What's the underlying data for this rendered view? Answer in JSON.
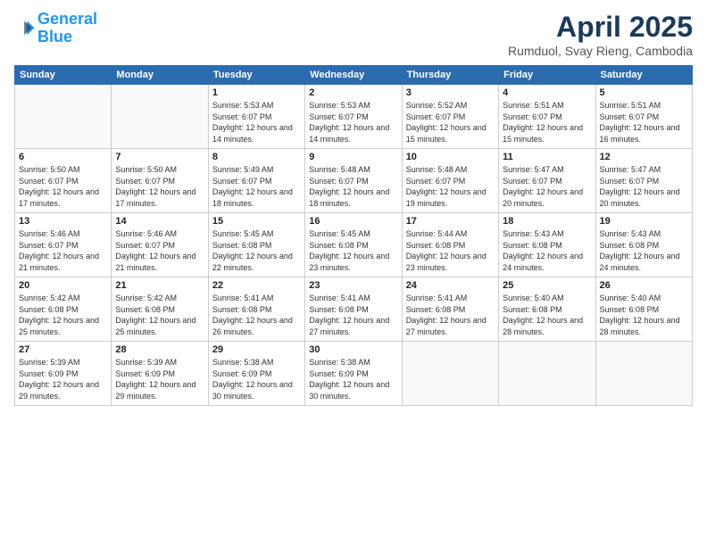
{
  "header": {
    "logo_line1": "General",
    "logo_line2": "Blue",
    "title": "April 2025",
    "subtitle": "Rumduol, Svay Rieng, Cambodia"
  },
  "weekdays": [
    "Sunday",
    "Monday",
    "Tuesday",
    "Wednesday",
    "Thursday",
    "Friday",
    "Saturday"
  ],
  "weeks": [
    [
      {
        "day": "",
        "sunrise": "",
        "sunset": "",
        "daylight": ""
      },
      {
        "day": "",
        "sunrise": "",
        "sunset": "",
        "daylight": ""
      },
      {
        "day": "1",
        "sunrise": "Sunrise: 5:53 AM",
        "sunset": "Sunset: 6:07 PM",
        "daylight": "Daylight: 12 hours and 14 minutes."
      },
      {
        "day": "2",
        "sunrise": "Sunrise: 5:53 AM",
        "sunset": "Sunset: 6:07 PM",
        "daylight": "Daylight: 12 hours and 14 minutes."
      },
      {
        "day": "3",
        "sunrise": "Sunrise: 5:52 AM",
        "sunset": "Sunset: 6:07 PM",
        "daylight": "Daylight: 12 hours and 15 minutes."
      },
      {
        "day": "4",
        "sunrise": "Sunrise: 5:51 AM",
        "sunset": "Sunset: 6:07 PM",
        "daylight": "Daylight: 12 hours and 15 minutes."
      },
      {
        "day": "5",
        "sunrise": "Sunrise: 5:51 AM",
        "sunset": "Sunset: 6:07 PM",
        "daylight": "Daylight: 12 hours and 16 minutes."
      }
    ],
    [
      {
        "day": "6",
        "sunrise": "Sunrise: 5:50 AM",
        "sunset": "Sunset: 6:07 PM",
        "daylight": "Daylight: 12 hours and 17 minutes."
      },
      {
        "day": "7",
        "sunrise": "Sunrise: 5:50 AM",
        "sunset": "Sunset: 6:07 PM",
        "daylight": "Daylight: 12 hours and 17 minutes."
      },
      {
        "day": "8",
        "sunrise": "Sunrise: 5:49 AM",
        "sunset": "Sunset: 6:07 PM",
        "daylight": "Daylight: 12 hours and 18 minutes."
      },
      {
        "day": "9",
        "sunrise": "Sunrise: 5:48 AM",
        "sunset": "Sunset: 6:07 PM",
        "daylight": "Daylight: 12 hours and 18 minutes."
      },
      {
        "day": "10",
        "sunrise": "Sunrise: 5:48 AM",
        "sunset": "Sunset: 6:07 PM",
        "daylight": "Daylight: 12 hours and 19 minutes."
      },
      {
        "day": "11",
        "sunrise": "Sunrise: 5:47 AM",
        "sunset": "Sunset: 6:07 PM",
        "daylight": "Daylight: 12 hours and 20 minutes."
      },
      {
        "day": "12",
        "sunrise": "Sunrise: 5:47 AM",
        "sunset": "Sunset: 6:07 PM",
        "daylight": "Daylight: 12 hours and 20 minutes."
      }
    ],
    [
      {
        "day": "13",
        "sunrise": "Sunrise: 5:46 AM",
        "sunset": "Sunset: 6:07 PM",
        "daylight": "Daylight: 12 hours and 21 minutes."
      },
      {
        "day": "14",
        "sunrise": "Sunrise: 5:46 AM",
        "sunset": "Sunset: 6:07 PM",
        "daylight": "Daylight: 12 hours and 21 minutes."
      },
      {
        "day": "15",
        "sunrise": "Sunrise: 5:45 AM",
        "sunset": "Sunset: 6:08 PM",
        "daylight": "Daylight: 12 hours and 22 minutes."
      },
      {
        "day": "16",
        "sunrise": "Sunrise: 5:45 AM",
        "sunset": "Sunset: 6:08 PM",
        "daylight": "Daylight: 12 hours and 23 minutes."
      },
      {
        "day": "17",
        "sunrise": "Sunrise: 5:44 AM",
        "sunset": "Sunset: 6:08 PM",
        "daylight": "Daylight: 12 hours and 23 minutes."
      },
      {
        "day": "18",
        "sunrise": "Sunrise: 5:43 AM",
        "sunset": "Sunset: 6:08 PM",
        "daylight": "Daylight: 12 hours and 24 minutes."
      },
      {
        "day": "19",
        "sunrise": "Sunrise: 5:43 AM",
        "sunset": "Sunset: 6:08 PM",
        "daylight": "Daylight: 12 hours and 24 minutes."
      }
    ],
    [
      {
        "day": "20",
        "sunrise": "Sunrise: 5:42 AM",
        "sunset": "Sunset: 6:08 PM",
        "daylight": "Daylight: 12 hours and 25 minutes."
      },
      {
        "day": "21",
        "sunrise": "Sunrise: 5:42 AM",
        "sunset": "Sunset: 6:08 PM",
        "daylight": "Daylight: 12 hours and 25 minutes."
      },
      {
        "day": "22",
        "sunrise": "Sunrise: 5:41 AM",
        "sunset": "Sunset: 6:08 PM",
        "daylight": "Daylight: 12 hours and 26 minutes."
      },
      {
        "day": "23",
        "sunrise": "Sunrise: 5:41 AM",
        "sunset": "Sunset: 6:08 PM",
        "daylight": "Daylight: 12 hours and 27 minutes."
      },
      {
        "day": "24",
        "sunrise": "Sunrise: 5:41 AM",
        "sunset": "Sunset: 6:08 PM",
        "daylight": "Daylight: 12 hours and 27 minutes."
      },
      {
        "day": "25",
        "sunrise": "Sunrise: 5:40 AM",
        "sunset": "Sunset: 6:08 PM",
        "daylight": "Daylight: 12 hours and 28 minutes."
      },
      {
        "day": "26",
        "sunrise": "Sunrise: 5:40 AM",
        "sunset": "Sunset: 6:08 PM",
        "daylight": "Daylight: 12 hours and 28 minutes."
      }
    ],
    [
      {
        "day": "27",
        "sunrise": "Sunrise: 5:39 AM",
        "sunset": "Sunset: 6:09 PM",
        "daylight": "Daylight: 12 hours and 29 minutes."
      },
      {
        "day": "28",
        "sunrise": "Sunrise: 5:39 AM",
        "sunset": "Sunset: 6:09 PM",
        "daylight": "Daylight: 12 hours and 29 minutes."
      },
      {
        "day": "29",
        "sunrise": "Sunrise: 5:38 AM",
        "sunset": "Sunset: 6:09 PM",
        "daylight": "Daylight: 12 hours and 30 minutes."
      },
      {
        "day": "30",
        "sunrise": "Sunrise: 5:38 AM",
        "sunset": "Sunset: 6:09 PM",
        "daylight": "Daylight: 12 hours and 30 minutes."
      },
      {
        "day": "",
        "sunrise": "",
        "sunset": "",
        "daylight": ""
      },
      {
        "day": "",
        "sunrise": "",
        "sunset": "",
        "daylight": ""
      },
      {
        "day": "",
        "sunrise": "",
        "sunset": "",
        "daylight": ""
      }
    ]
  ]
}
